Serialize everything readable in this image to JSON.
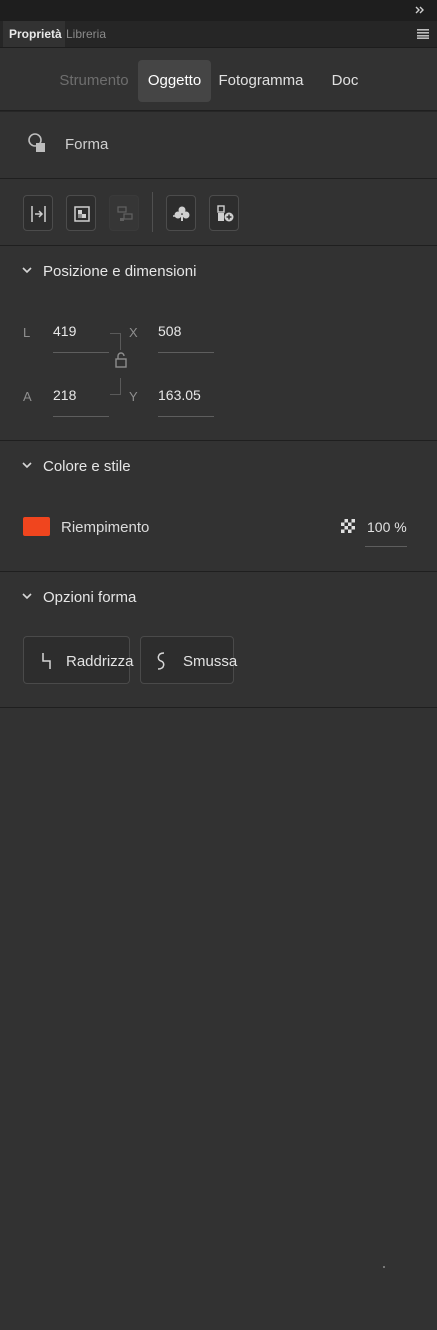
{
  "panel": {
    "tabs": [
      "Proprietà",
      "Libreria"
    ]
  },
  "mode_tabs": [
    {
      "label": "Strumento",
      "state": "disabled"
    },
    {
      "label": "Oggetto",
      "state": "selected"
    },
    {
      "label": "Fotogramma",
      "state": "normal"
    },
    {
      "label": "Doc",
      "state": "normal"
    }
  ],
  "object": {
    "icon": "shape-icon",
    "type_label": "Forma"
  },
  "toolbar": {
    "buttons": [
      {
        "icon": "align-icon",
        "enabled": true
      },
      {
        "icon": "convert-to-bitmap-icon",
        "enabled": true
      },
      {
        "icon": "break-apart-icon",
        "enabled": false
      },
      {
        "icon": "convert-to-symbol-icon",
        "enabled": true
      },
      {
        "icon": "add-to-library-icon",
        "enabled": true
      }
    ]
  },
  "position_size": {
    "title": "Posizione e dimensioni",
    "width_label": "L",
    "width_value": "419",
    "height_label": "A",
    "height_value": "218",
    "x_label": "X",
    "x_value": "508",
    "y_label": "Y",
    "y_value": "163.05"
  },
  "color_style": {
    "title": "Colore e stile",
    "fill_label": "Riempimento",
    "fill_color": "#f0451e",
    "alpha_value": "100 %"
  },
  "shape_options": {
    "title": "Opzioni forma",
    "straighten_label": "Raddrizza",
    "smooth_label": "Smussa"
  },
  "colors": {
    "panel_bg": "#323232",
    "selected_tab_bg": "#454545",
    "fill": "#f0451e"
  }
}
